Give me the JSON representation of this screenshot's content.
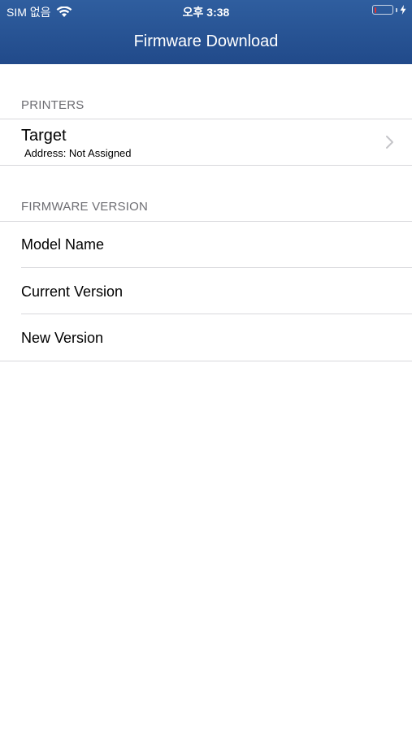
{
  "status_bar": {
    "carrier": "SIM 없음",
    "time": "오후 3:38",
    "battery_level": 0.1
  },
  "nav": {
    "title": "Firmware Download"
  },
  "printers": {
    "header": "PRINTERS",
    "target": {
      "title": "Target",
      "subtitle": "Address: Not Assigned"
    }
  },
  "firmware_version": {
    "header": "FIRMWARE VERSION",
    "rows": [
      {
        "label": "Model Name"
      },
      {
        "label": "Current Version"
      },
      {
        "label": "New Version"
      }
    ]
  },
  "colors": {
    "nav_bar": "#214a8a",
    "battery_low": "#e0302f",
    "section_header": "#6d6d72",
    "separator": "#d8d8dc"
  }
}
